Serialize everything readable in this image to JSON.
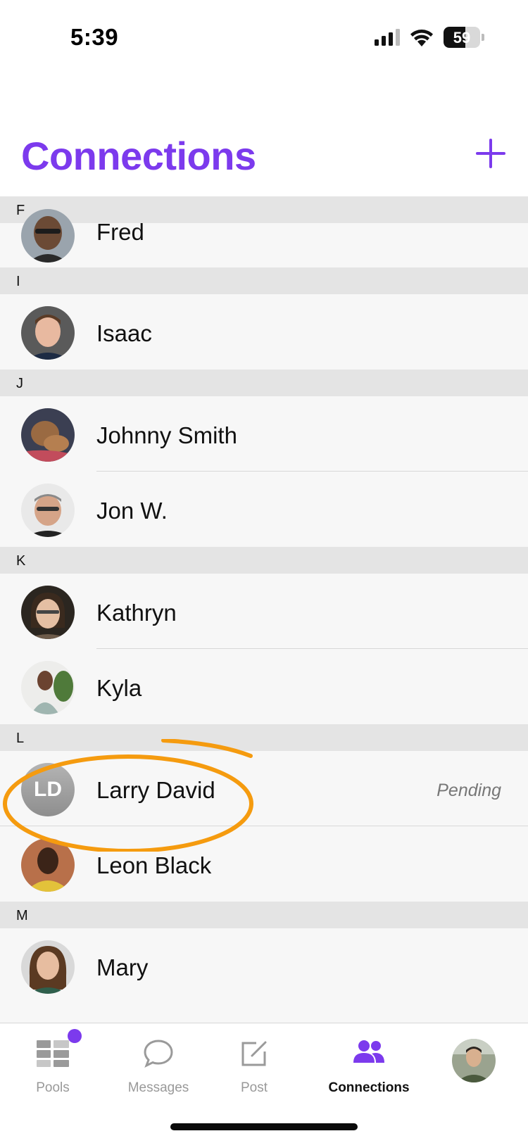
{
  "status_bar": {
    "time": "5:39",
    "battery": "59",
    "battery_level": 0.59
  },
  "header": {
    "title": "Connections",
    "add_icon": "plus-icon"
  },
  "sections": [
    {
      "letter": "F",
      "contacts": [
        {
          "name": "Fred",
          "avatar": "photo-man-glasses"
        }
      ]
    },
    {
      "letter": "I",
      "contacts": [
        {
          "name": "Isaac",
          "avatar": "photo-young-man"
        }
      ]
    },
    {
      "letter": "J",
      "contacts": [
        {
          "name": "Johnny Smith",
          "avatar": "photo-dog"
        },
        {
          "name": "Jon W.",
          "avatar": "photo-man-glasses"
        }
      ]
    },
    {
      "letter": "K",
      "contacts": [
        {
          "name": "Kathryn",
          "avatar": "photo-woman-glasses"
        },
        {
          "name": "Kyla",
          "avatar": "photo-woman"
        }
      ]
    },
    {
      "letter": "L",
      "contacts": [
        {
          "name": "Larry David",
          "initials": "LD",
          "status": "Pending"
        },
        {
          "name": "Leon Black",
          "avatar": "photo-man"
        }
      ]
    },
    {
      "letter": "M",
      "contacts": [
        {
          "name": "Mary",
          "avatar": "photo-woman-smiling"
        }
      ]
    }
  ],
  "tab_bar": {
    "tabs": [
      {
        "label": "Pools",
        "icon": "pools-icon",
        "has_badge": true
      },
      {
        "label": "Messages",
        "icon": "chat-bubble-icon"
      },
      {
        "label": "Post",
        "icon": "compose-icon"
      },
      {
        "label": "Connections",
        "icon": "people-icon",
        "active": true
      }
    ],
    "profile_icon": "profile-avatar"
  },
  "colors": {
    "accent": "#7c3aed",
    "highlight": "#f59b0f",
    "section_bg": "#e4e4e4",
    "row_bg": "#f7f7f7"
  }
}
